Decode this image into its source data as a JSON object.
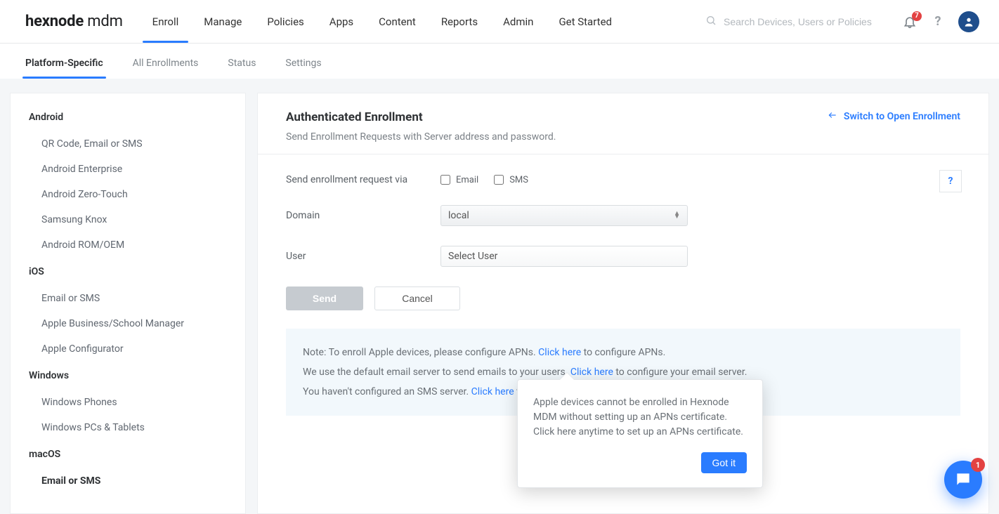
{
  "brand": {
    "part1": "hexnode",
    "part2": " mdm"
  },
  "nav": {
    "items": [
      "Enroll",
      "Manage",
      "Policies",
      "Apps",
      "Content",
      "Reports",
      "Admin",
      "Get Started"
    ],
    "active": "Enroll"
  },
  "search": {
    "placeholder": "Search Devices, Users or Policies"
  },
  "notifications": {
    "count": "7"
  },
  "subtabs": {
    "items": [
      "Platform-Specific",
      "All Enrollments",
      "Status",
      "Settings"
    ],
    "active": "Platform-Specific"
  },
  "sidebar": {
    "groups": [
      {
        "label": "Android",
        "items": [
          "QR Code, Email or SMS",
          "Android Enterprise",
          "Android Zero-Touch",
          "Samsung Knox",
          "Android ROM/OEM"
        ]
      },
      {
        "label": "iOS",
        "items": [
          "Email or SMS",
          "Apple Business/School Manager",
          "Apple Configurator"
        ]
      },
      {
        "label": "Windows",
        "items": [
          "Windows Phones",
          "Windows PCs & Tablets"
        ]
      },
      {
        "label": "macOS",
        "items": [
          "Email or SMS"
        ]
      }
    ],
    "selected": "macOS/Email or SMS"
  },
  "main": {
    "title": "Authenticated Enrollment",
    "subtitle": "Send Enrollment Requests with Server address and password.",
    "switch_link": "Switch to Open Enrollment"
  },
  "form": {
    "send_via_label": "Send enrollment request via",
    "email_label": "Email",
    "sms_label": "SMS",
    "domain_label": "Domain",
    "domain_value": "local",
    "user_label": "User",
    "user_value": "Select User",
    "send_btn": "Send",
    "cancel_btn": "Cancel"
  },
  "note": {
    "line1_a": "Note: To enroll Apple devices, please configure APNs. ",
    "line1_link": "Click here",
    "line1_b": "  to configure APNs.",
    "line2_a": "We use the default email server to send emails to your users. ",
    "line2_link": "Click here",
    "line2_b": "  to configure your email server.",
    "line3_a": "You haven't configured an SMS server.  ",
    "line3_link": "Click here",
    "line3_b": "  to configure SMS gateway."
  },
  "popover": {
    "text": "Apple devices cannot be enrolled in Hexnode MDM without setting up an APNs certificate. Click here anytime to set up an APNs certificate.",
    "button": "Got it"
  },
  "chat": {
    "badge": "1"
  }
}
